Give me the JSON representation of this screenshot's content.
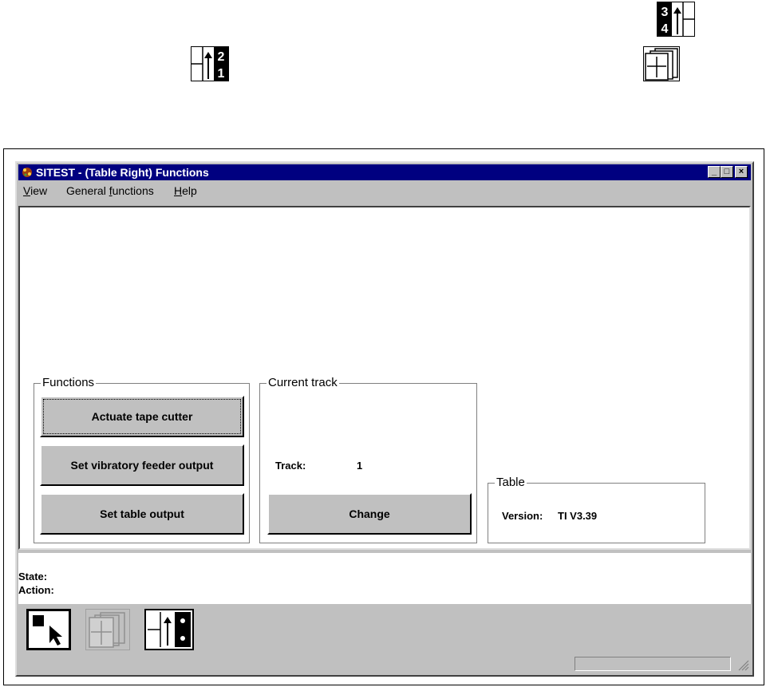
{
  "window": {
    "title": "SITEST - (Table Right) Functions",
    "minimize_glyph": "_",
    "maximize_glyph": "□",
    "close_glyph": "×"
  },
  "menu": {
    "items": [
      {
        "access_key": "V",
        "rest": "iew"
      },
      {
        "prefix": "General ",
        "access_key": "f",
        "rest": "unctions"
      },
      {
        "access_key": "H",
        "rest": "elp"
      }
    ]
  },
  "functions": {
    "label": "Functions",
    "buttons": [
      "Actuate tape cutter",
      "Set vibratory feeder output",
      "Set table output"
    ]
  },
  "current_track": {
    "label": "Current track",
    "track_label": "Track:",
    "track_value": "1",
    "change_label": "Change"
  },
  "table": {
    "label": "Table",
    "version_label": "Version:",
    "version_value": "TI V3.39"
  },
  "status": {
    "state_label": "State:",
    "action_label": "Action:"
  },
  "floating_icons": {
    "icon_34": {
      "top": "3",
      "bottom": "4"
    },
    "icon_21": {
      "top": "2",
      "bottom": "1"
    }
  },
  "colors": {
    "titlebar": "#000080",
    "window_face": "#c0c0c0"
  }
}
